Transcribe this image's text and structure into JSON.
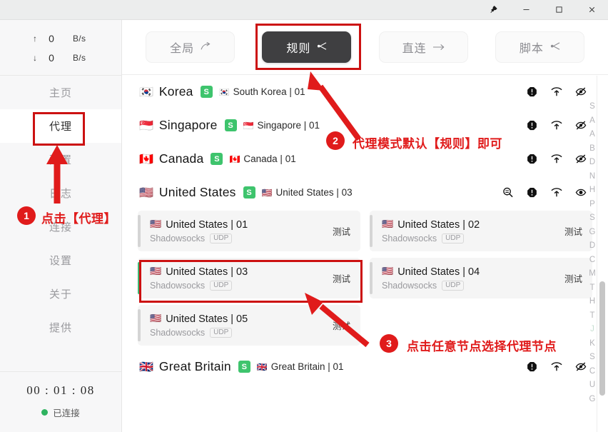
{
  "titlebar": {
    "buttons": [
      {
        "name": "pin-icon",
        "label": "📌"
      },
      {
        "name": "minimize-icon",
        "label": "−"
      },
      {
        "name": "maximize-icon",
        "label": "□"
      },
      {
        "name": "close-icon",
        "label": "✕"
      }
    ]
  },
  "sidebar": {
    "speed": {
      "upload": {
        "arrow": "↑",
        "value": "0",
        "unit": "B/s"
      },
      "download": {
        "arrow": "↓",
        "value": "0",
        "unit": "B/s"
      }
    },
    "items": [
      {
        "label": "主页",
        "active": false
      },
      {
        "label": "代理",
        "active": true
      },
      {
        "label": "配置",
        "active": false
      },
      {
        "label": "日志",
        "active": false
      },
      {
        "label": "连接",
        "active": false
      },
      {
        "label": "设置",
        "active": false
      },
      {
        "label": "关于",
        "active": false
      },
      {
        "label": "提供",
        "active": false
      }
    ],
    "status": {
      "timer": "00 : 01 : 08",
      "connection": "已连接",
      "dot_color": "#2fb360"
    }
  },
  "modes": [
    {
      "label": "全局",
      "icon": "➤",
      "selected": false
    },
    {
      "label": "规则",
      "icon": "⋜",
      "selected": true
    },
    {
      "label": "直连",
      "icon": "→",
      "selected": false
    },
    {
      "label": "脚本",
      "icon": "⋖",
      "selected": false
    }
  ],
  "groups": [
    {
      "flag": "🇰🇷",
      "name": "Korea",
      "badge": "S",
      "selected_flag": "🇰🇷",
      "selected_node": "South Korea | 01",
      "expanded": false,
      "icons": [
        "alert-icon",
        "latency-icon",
        "eye-off-icon"
      ]
    },
    {
      "flag": "🇸🇬",
      "name": "Singapore",
      "badge": "S",
      "selected_flag": "🇸🇬",
      "selected_node": "Singapore | 01",
      "expanded": false,
      "icons": [
        "alert-icon",
        "latency-icon",
        "eye-off-icon"
      ]
    },
    {
      "flag": "🇨🇦",
      "name": "Canada",
      "badge": "S",
      "selected_flag": "🇨🇦",
      "selected_node": "Canada | 01",
      "expanded": false,
      "icons": [
        "alert-icon",
        "latency-icon",
        "eye-off-icon"
      ]
    },
    {
      "flag": "🇺🇸",
      "name": "United States",
      "badge": "S",
      "selected_flag": "🇺🇸",
      "selected_node": "United States | 03",
      "expanded": true,
      "icons": [
        "search-icon",
        "alert-icon",
        "latency-icon",
        "eye-icon"
      ]
    }
  ],
  "nodes": [
    {
      "flag": "🇺🇸",
      "name": "United States | 01",
      "protocol": "Shadowsocks",
      "udp": "UDP",
      "test": "测试",
      "selected": false
    },
    {
      "flag": "🇺🇸",
      "name": "United States | 02",
      "protocol": "Shadowsocks",
      "udp": "UDP",
      "test": "测试",
      "selected": false
    },
    {
      "flag": "🇺🇸",
      "name": "United States | 03",
      "protocol": "Shadowsocks",
      "udp": "UDP",
      "test": "测试",
      "selected": true
    },
    {
      "flag": "🇺🇸",
      "name": "United States | 04",
      "protocol": "Shadowsocks",
      "udp": "UDP",
      "test": "测试",
      "selected": false
    },
    {
      "flag": "🇺🇸",
      "name": "United States | 05",
      "protocol": "Shadowsocks",
      "udp": "UDP",
      "test": "测试",
      "selected": false
    }
  ],
  "group_bottom": {
    "flag": "🇬🇧",
    "name": "Great Britain",
    "badge": "S",
    "selected_flag": "🇬🇧",
    "selected_node": "Great Britain | 01",
    "icons": [
      "alert-icon",
      "latency-icon",
      "eye-off-icon"
    ]
  },
  "index_letters": [
    "S",
    "A",
    "A",
    "B",
    "D",
    "N",
    "H",
    "P",
    "S",
    "G",
    "D",
    "C",
    "M",
    "T",
    "H",
    "T",
    "J",
    "K",
    "S",
    "C",
    "U",
    "G"
  ],
  "annotations": [
    {
      "number": "1",
      "text": "点击【代理】"
    },
    {
      "number": "2",
      "text": "代理模式默认【规则】即可"
    },
    {
      "number": "3",
      "text": "点击任意节点选择代理节点"
    }
  ],
  "colors": {
    "accent_red": "#e01b1b",
    "selected_green": "#3fb773",
    "badge_green": "#3ec46d",
    "mode_selected_bg": "#3f3f41"
  }
}
